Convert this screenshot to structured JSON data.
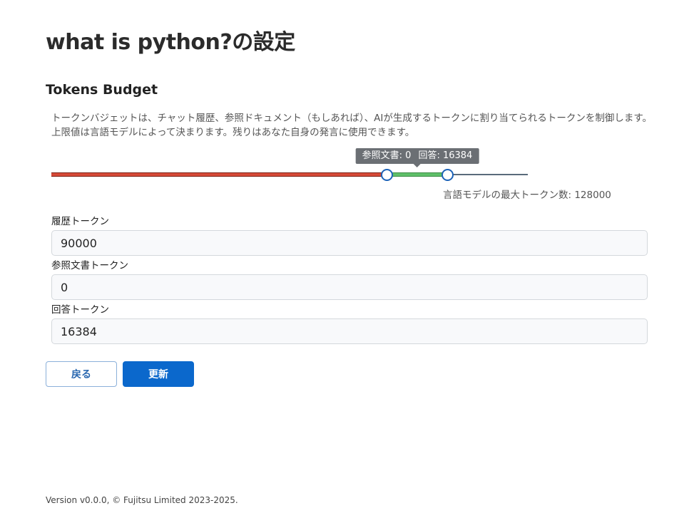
{
  "page": {
    "title": "what is python?の設定"
  },
  "tokens_budget": {
    "title": "Tokens Budget",
    "description": "トークンバジェットは、チャット履歴、参照ドキュメント（もしあれば）、AIが生成するトークンに割り当てられるトークンを制御します。上限値は言語モデルによって決まります。残りはあなた自身の発言に使用できます。",
    "slider": {
      "history_tokens": 90000,
      "reference_tokens": 0,
      "answer_tokens": 16384,
      "max_tokens": 128000,
      "tooltip_reference": "参照文書: 0",
      "tooltip_answer": "回答: 16384",
      "max_label": "言語モデルの最大トークン数: 128000",
      "colors": {
        "history": "#d64a38",
        "reference": "#5fc06a",
        "rest": "#5a6b7b",
        "handle": "#1d63b8"
      }
    },
    "fields": {
      "history": {
        "label": "履歴トークン",
        "value": "90000"
      },
      "reference": {
        "label": "参照文書トークン",
        "value": "0"
      },
      "answer": {
        "label": "回答トークン",
        "value": "16384"
      }
    }
  },
  "buttons": {
    "back": "戻る",
    "update": "更新"
  },
  "footer": {
    "text": "Version v0.0.0, © Fujitsu Limited 2023-2025."
  }
}
